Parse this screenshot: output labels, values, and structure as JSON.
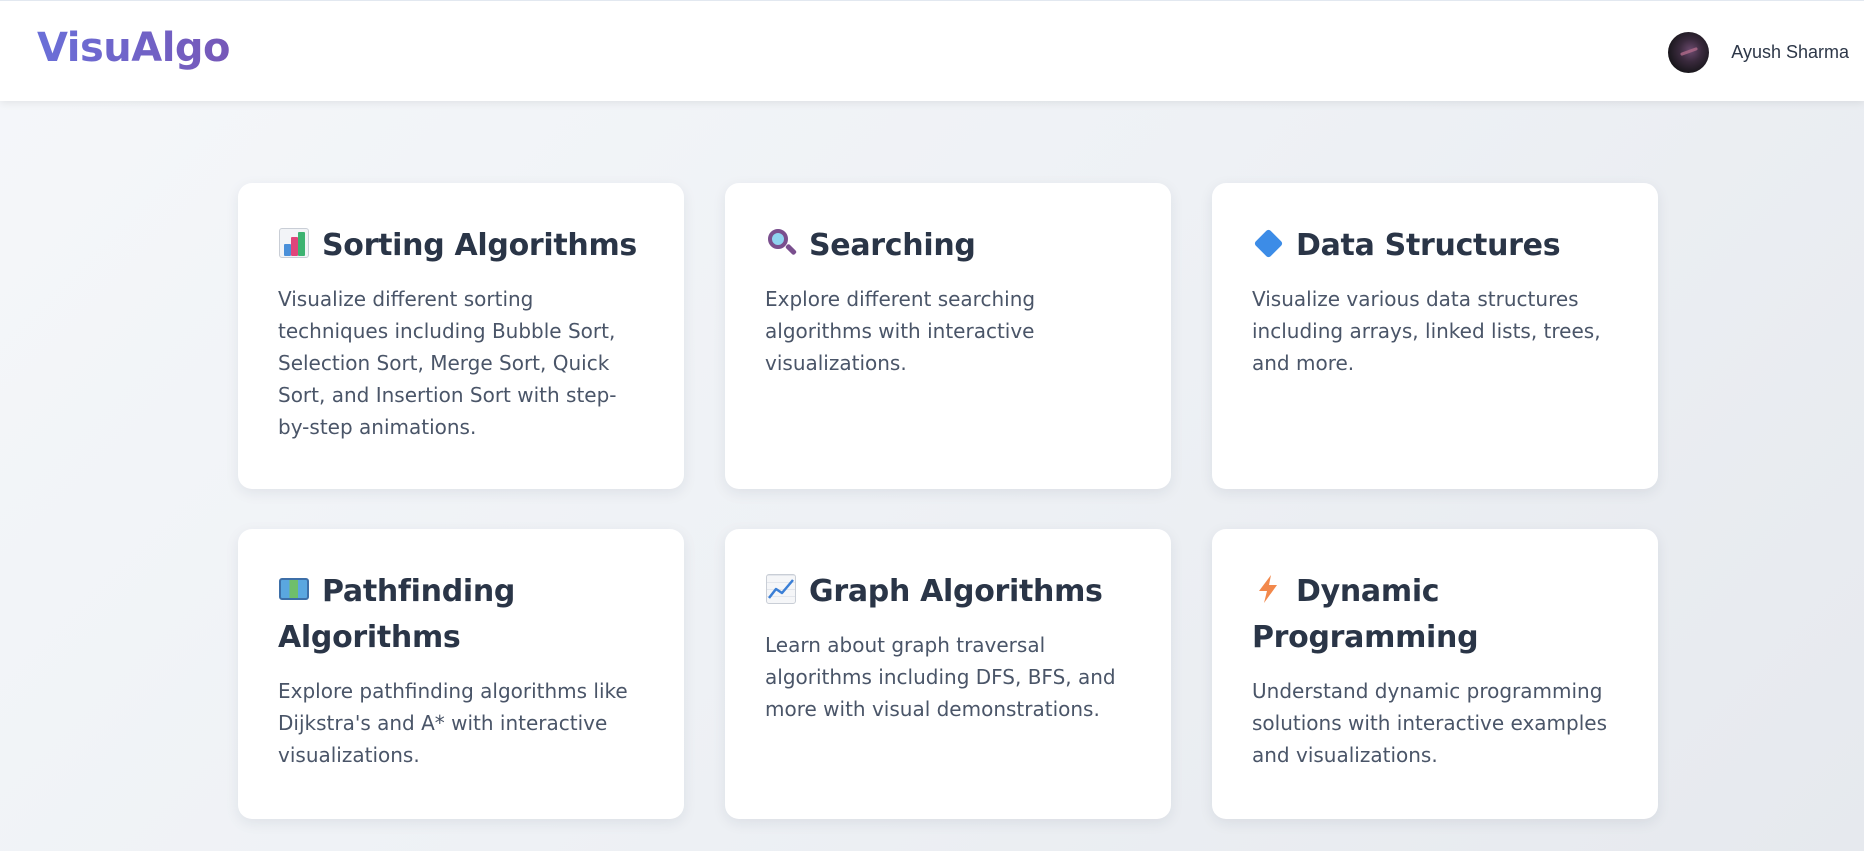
{
  "header": {
    "logo": "VisuAlgo",
    "user_name": "Ayush Sharma"
  },
  "cards": [
    {
      "icon": "bar-chart-icon",
      "title": "Sorting Algorithms",
      "description": "Visualize different sorting techniques including Bubble Sort, Selection Sort, Merge Sort, Quick Sort, and Insertion Sort with step-by-step animations."
    },
    {
      "icon": "magnifying-glass-icon",
      "title": "Searching",
      "description": "Explore different searching algorithms with interactive visualizations."
    },
    {
      "icon": "blue-diamond-icon",
      "title": "Data Structures",
      "description": "Visualize various data structures including arrays, linked lists, trees, and more."
    },
    {
      "icon": "world-map-icon",
      "title": "Pathfinding Algorithms",
      "description": "Explore pathfinding algorithms like Dijkstra's and A* with interactive visualizations."
    },
    {
      "icon": "line-chart-icon",
      "title": "Graph Algorithms",
      "description": "Learn about graph traversal algorithms including DFS, BFS, and more with visual demonstrations."
    },
    {
      "icon": "lightning-bolt-icon",
      "title": "Dynamic Programming",
      "description": "Understand dynamic programming solutions with interactive examples and visualizations."
    }
  ]
}
